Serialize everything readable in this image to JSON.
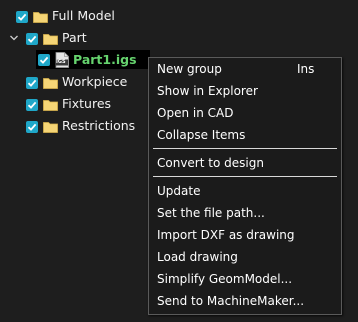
{
  "tree": {
    "root": {
      "label": "Full Model",
      "checked": true
    },
    "part": {
      "label": "Part",
      "checked": true,
      "expanded": true
    },
    "part_file": {
      "label": "Part1.igs",
      "checked": true,
      "selected": true,
      "file_icon_text": "IGS"
    },
    "workpiece": {
      "label": "Workpiece",
      "checked": true
    },
    "fixtures": {
      "label": "Fixtures",
      "checked": true
    },
    "restrictions": {
      "label": "Restrictions",
      "checked": true
    }
  },
  "context_menu": {
    "new_group": {
      "label": "New group",
      "shortcut": "Ins"
    },
    "show_in_explorer": {
      "label": "Show in Explorer"
    },
    "open_in_cad": {
      "label": "Open in CAD"
    },
    "collapse_items": {
      "label": "Collapse Items"
    },
    "convert_to_design": {
      "label": "Convert to design"
    },
    "update": {
      "label": "Update"
    },
    "set_file_path": {
      "label": "Set the file path..."
    },
    "import_dxf": {
      "label": "Import DXF as drawing"
    },
    "load_drawing": {
      "label": "Load drawing"
    },
    "simplify_geom": {
      "label": "Simplify GeomModel..."
    },
    "send_to_machinemaker": {
      "label": "Send to MachineMaker..."
    }
  },
  "colors": {
    "background": "#1e1e1e",
    "checkbox": "#1fa7c8",
    "folder": "#f5d576",
    "selected_file_text": "#66d36e",
    "menu_background": "#1b1b1b",
    "menu_border": "#5a5a5a"
  }
}
